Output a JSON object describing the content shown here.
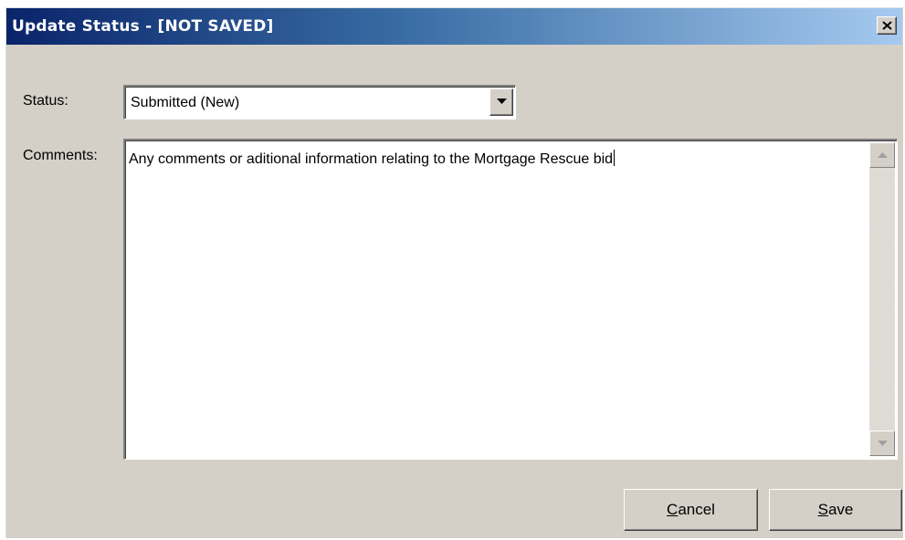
{
  "window": {
    "title": "Update Status - [NOT SAVED]",
    "close_label": "×"
  },
  "form": {
    "status_label": "Status:",
    "status_value": "Submitted (New)",
    "comments_label": "Comments:",
    "comments_value": "Any comments or aditional information relating to the Mortgage Rescue bid"
  },
  "buttons": {
    "cancel_mnemonic": "C",
    "cancel_rest": "ancel",
    "save_mnemonic": "S",
    "save_rest": "ave"
  },
  "colors": {
    "title_gradient_start": "#0a246a",
    "title_gradient_end": "#a6caf0",
    "dialog_face": "#d4d0c8"
  },
  "icons": {
    "close": "close-icon",
    "dropdown": "chevron-down-icon",
    "scroll_up": "scroll-up-arrow-icon",
    "scroll_down": "scroll-down-arrow-icon"
  }
}
